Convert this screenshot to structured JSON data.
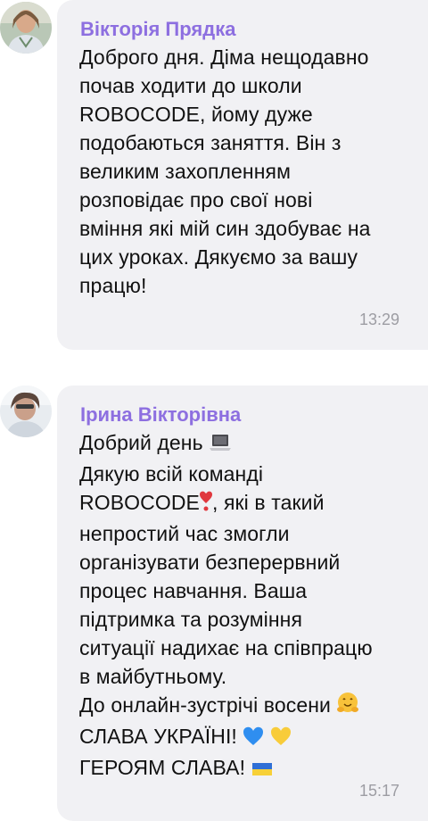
{
  "messages": [
    {
      "sender": "Вікторія Прядка",
      "lines": [
        "Доброго дня. Діма нещодавно",
        "почав ходити до школи",
        "ROBOCODE, йому дуже",
        "подобаються заняття. Він з",
        "великим захопленням",
        "розповідає про свої нові",
        "вміння які мій син здобуває на",
        "цих уроках. Дякуємо за вашу",
        "працю!"
      ],
      "time": "13:29"
    },
    {
      "sender": "Ірина Вікторівна",
      "lines": [
        "Добрий день",
        "Дякую всій команді",
        "ROBOCODE",
        "непростий час змогли",
        "організувати безперервний",
        "процес навчання. Ваша",
        "підтримка та розуміння",
        "ситуації надихає на співпрацю",
        "в майбутньому.",
        "До онлайн-зустрічі восени",
        "СЛАВА УКРАЇНІ!",
        "ГЕРОЯМ СЛАВА!"
      ],
      "line3_suffix": ", які в такий",
      "time": "15:17"
    }
  ],
  "icons": {
    "laptop": "laptop-emoji",
    "heart_exclamation": "heart-exclamation-emoji",
    "hug": "hugging-face-emoji",
    "blue_heart": "blue-heart-emoji",
    "yellow_heart": "yellow-heart-emoji",
    "flag": "ukraine-flag-emoji"
  },
  "colors": {
    "sender": "#8d6fe0",
    "bubble": "#f1f1f4",
    "time": "#9d9da3"
  }
}
